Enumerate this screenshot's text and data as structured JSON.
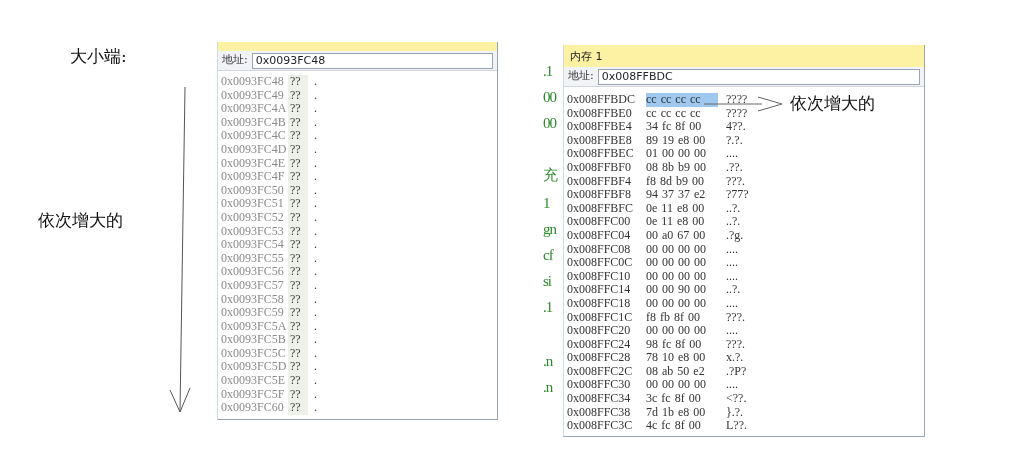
{
  "annotations": [
    {
      "kind": "title",
      "text": "大小端:"
    },
    {
      "kind": "left-note",
      "text": "依次增大的"
    },
    {
      "kind": "right-note",
      "text": "依次增大的"
    }
  ],
  "code_fragments": [
    ".1",
    "00",
    "00",
    "充",
    "1",
    "gn",
    "cf",
    "si",
    ".1",
    ".n",
    ".n"
  ],
  "left_memory": {
    "address_label": "地址:",
    "address": "0x0093FC48",
    "rows": [
      {
        "address": "0x0093FC48",
        "value": "??",
        "ascii": "."
      },
      {
        "address": "0x0093FC49",
        "value": "??",
        "ascii": "."
      },
      {
        "address": "0x0093FC4A",
        "value": "??",
        "ascii": "."
      },
      {
        "address": "0x0093FC4B",
        "value": "??",
        "ascii": "."
      },
      {
        "address": "0x0093FC4C",
        "value": "??",
        "ascii": "."
      },
      {
        "address": "0x0093FC4D",
        "value": "??",
        "ascii": "."
      },
      {
        "address": "0x0093FC4E",
        "value": "??",
        "ascii": "."
      },
      {
        "address": "0x0093FC4F",
        "value": "??",
        "ascii": "."
      },
      {
        "address": "0x0093FC50",
        "value": "??",
        "ascii": "."
      },
      {
        "address": "0x0093FC51",
        "value": "??",
        "ascii": "."
      },
      {
        "address": "0x0093FC52",
        "value": "??",
        "ascii": "."
      },
      {
        "address": "0x0093FC53",
        "value": "??",
        "ascii": "."
      },
      {
        "address": "0x0093FC54",
        "value": "??",
        "ascii": "."
      },
      {
        "address": "0x0093FC55",
        "value": "??",
        "ascii": "."
      },
      {
        "address": "0x0093FC56",
        "value": "??",
        "ascii": "."
      },
      {
        "address": "0x0093FC57",
        "value": "??",
        "ascii": "."
      },
      {
        "address": "0x0093FC58",
        "value": "??",
        "ascii": "."
      },
      {
        "address": "0x0093FC59",
        "value": "??",
        "ascii": "."
      },
      {
        "address": "0x0093FC5A",
        "value": "??",
        "ascii": "."
      },
      {
        "address": "0x0093FC5B",
        "value": "??",
        "ascii": "."
      },
      {
        "address": "0x0093FC5C",
        "value": "??",
        "ascii": "."
      },
      {
        "address": "0x0093FC5D",
        "value": "??",
        "ascii": "."
      },
      {
        "address": "0x0093FC5E",
        "value": "??",
        "ascii": "."
      },
      {
        "address": "0x0093FC5F",
        "value": "??",
        "ascii": "."
      },
      {
        "address": "0x0093FC60",
        "value": "??",
        "ascii": "."
      }
    ]
  },
  "right_memory": {
    "title": "内存 1",
    "address_label": "地址:",
    "address": "0x008FFBDC",
    "rows": [
      {
        "address": "0x008FFBDC",
        "bytes": "cc cc cc cc",
        "ascii": "????",
        "selected": true
      },
      {
        "address": "0x008FFBE0",
        "bytes": "cc cc cc cc",
        "ascii": "????",
        "selected": false
      },
      {
        "address": "0x008FFBE4",
        "bytes": "34 fc 8f 00",
        "ascii": "4??.",
        "selected": false
      },
      {
        "address": "0x008FFBE8",
        "bytes": "89 19 e8 00",
        "ascii": "?.?.",
        "selected": false
      },
      {
        "address": "0x008FFBEC",
        "bytes": "01 00 00 00",
        "ascii": "....",
        "selected": false
      },
      {
        "address": "0x008FFBF0",
        "bytes": "08 8b b9 00",
        "ascii": ".??.",
        "selected": false
      },
      {
        "address": "0x008FFBF4",
        "bytes": "f8 8d b9 00",
        "ascii": "???.",
        "selected": false
      },
      {
        "address": "0x008FFBF8",
        "bytes": "94 37 37 e2",
        "ascii": "?77?",
        "selected": false
      },
      {
        "address": "0x008FFBFC",
        "bytes": "0e 11 e8 00",
        "ascii": "..?.",
        "selected": false
      },
      {
        "address": "0x008FFC00",
        "bytes": "0e 11 e8 00",
        "ascii": "..?.",
        "selected": false
      },
      {
        "address": "0x008FFC04",
        "bytes": "00 a0 67 00",
        "ascii": ".?g.",
        "selected": false
      },
      {
        "address": "0x008FFC08",
        "bytes": "00 00 00 00",
        "ascii": "....",
        "selected": false
      },
      {
        "address": "0x008FFC0C",
        "bytes": "00 00 00 00",
        "ascii": "....",
        "selected": false
      },
      {
        "address": "0x008FFC10",
        "bytes": "00 00 00 00",
        "ascii": "....",
        "selected": false
      },
      {
        "address": "0x008FFC14",
        "bytes": "00 00 90 00",
        "ascii": "..?.",
        "selected": false
      },
      {
        "address": "0x008FFC18",
        "bytes": "00 00 00 00",
        "ascii": "....",
        "selected": false
      },
      {
        "address": "0x008FFC1C",
        "bytes": "f8 fb 8f 00",
        "ascii": "???.",
        "selected": false
      },
      {
        "address": "0x008FFC20",
        "bytes": "00 00 00 00",
        "ascii": "....",
        "selected": false
      },
      {
        "address": "0x008FFC24",
        "bytes": "98 fc 8f 00",
        "ascii": "???.",
        "selected": false
      },
      {
        "address": "0x008FFC28",
        "bytes": "78 10 e8 00",
        "ascii": "x.?.",
        "selected": false
      },
      {
        "address": "0x008FFC2C",
        "bytes": "08 ab 50 e2",
        "ascii": ".?P?",
        "selected": false
      },
      {
        "address": "0x008FFC30",
        "bytes": "00 00 00 00",
        "ascii": "....",
        "selected": false
      },
      {
        "address": "0x008FFC34",
        "bytes": "3c fc 8f 00",
        "ascii": "<??.",
        "selected": false
      },
      {
        "address": "0x008FFC38",
        "bytes": "7d 1b e8 00",
        "ascii": "}.?.",
        "selected": false
      },
      {
        "address": "0x008FFC3C",
        "bytes": "4c fc 8f 00",
        "ascii": "L??.",
        "selected": false
      }
    ]
  }
}
